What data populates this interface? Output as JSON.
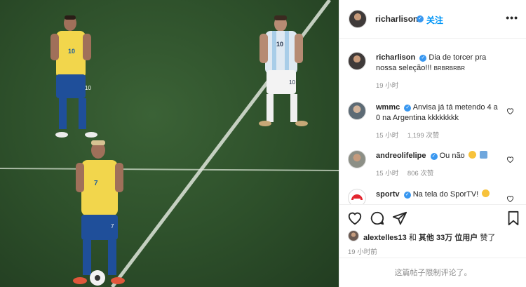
{
  "post": {
    "author": "richarlison",
    "follow_label": "关注",
    "more_label": "•••",
    "photo_alt": "Brazil and Argentina players standing on the pitch"
  },
  "players": {
    "left_top_number": "10",
    "left_top_shorts": "10",
    "left_bottom_number": "7",
    "left_bottom_shorts": "7",
    "right_number": "10",
    "right_shorts": "10"
  },
  "comments": [
    {
      "user": "richarlison",
      "text": "Dia de torcer pra nossa seleção!!! ",
      "suffix": "BRBRBRBR",
      "time": "19 小时"
    },
    {
      "user": "wmmc",
      "text": "Anvisa já tá metendo 4 a 0 na Argentina kkkkkkkk",
      "time": "15 小时",
      "likes": "1,199 次赞"
    },
    {
      "user": "andreolifelipe",
      "text": "Ou não",
      "time": "15 小时",
      "likes": "806 次赞"
    },
    {
      "user": "sportv",
      "text": "Na tela do SporTV!"
    }
  ],
  "likes": {
    "liker": "alextelles13",
    "and": " 和 ",
    "others": "其他 33万 位用户",
    "suffix": " 赞了"
  },
  "post_time": "19 小时前",
  "footer_text": "这篇帖子限制评论了。",
  "colors": {
    "accent": "#0095f6",
    "verified": "#3897f0",
    "muted": "#8e8e8e",
    "brazil_yellow": "#f5d94e",
    "brazil_blue": "#1b4f9c",
    "argentina_sky": "#a8cde8",
    "pitch": "#2f522c"
  }
}
